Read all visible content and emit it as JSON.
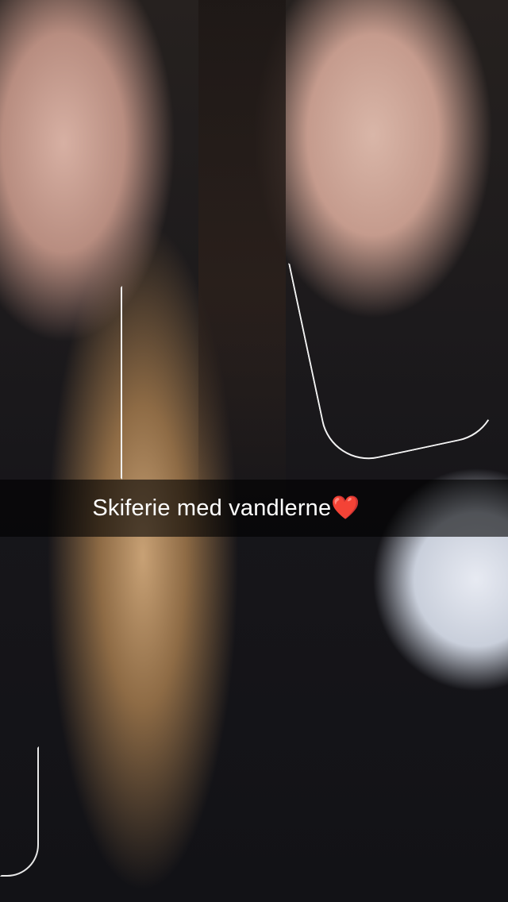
{
  "snap": {
    "caption": "Skiferie med vandlerne❤️"
  }
}
